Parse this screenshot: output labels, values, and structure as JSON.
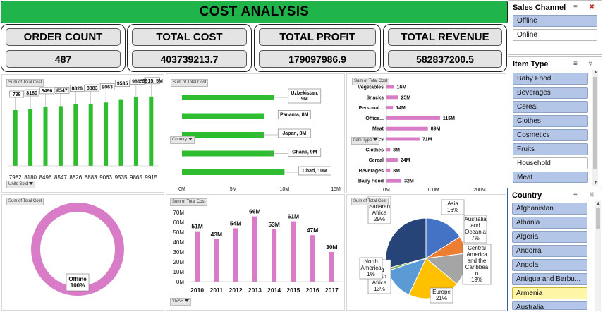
{
  "title": "COST ANALYSIS",
  "kpis": [
    {
      "label": "ORDER COUNT",
      "value": "487"
    },
    {
      "label": "TOTAL COST",
      "value": "403739213.7"
    },
    {
      "label": "TOTAL PROFIT",
      "value": "179097986.9"
    },
    {
      "label": "TOTAL REVENUE",
      "value": "582837200.5"
    }
  ],
  "field_buttons": {
    "sum_total_cost": "Sum of Total Cost",
    "units_sold": "Units Sold",
    "country": "Country",
    "item_type": "Item Type",
    "year": "YEAR"
  },
  "slicers": {
    "sales_channel": {
      "title": "Sales Channel",
      "items": [
        {
          "label": "Offline",
          "state": "selected"
        },
        {
          "label": "Online",
          "state": "unselected"
        }
      ]
    },
    "item_type": {
      "title": "Item Type",
      "items": [
        {
          "label": "Baby Food",
          "state": "selected"
        },
        {
          "label": "Beverages",
          "state": "selected"
        },
        {
          "label": "Cereal",
          "state": "selected"
        },
        {
          "label": "Clothes",
          "state": "selected"
        },
        {
          "label": "Cosmetics",
          "state": "selected"
        },
        {
          "label": "Fruits",
          "state": "selected"
        },
        {
          "label": "Household",
          "state": "unselected"
        },
        {
          "label": "Meat",
          "state": "selected"
        }
      ]
    },
    "country": {
      "title": "Country",
      "items": [
        {
          "label": "Afghanistan",
          "state": "selected"
        },
        {
          "label": "Albania",
          "state": "selected"
        },
        {
          "label": "Algeria",
          "state": "selected"
        },
        {
          "label": "Andorra",
          "state": "selected"
        },
        {
          "label": "Angola",
          "state": "selected"
        },
        {
          "label": "Antigua and Barbu...",
          "state": "selected"
        },
        {
          "label": "Armenia",
          "state": "highlighted"
        },
        {
          "label": "Australia",
          "state": "selected"
        }
      ]
    }
  },
  "chart_data": [
    {
      "id": "units",
      "type": "bar",
      "categories": [
        "7982",
        "8180",
        "8496",
        "8547",
        "8826",
        "8883",
        "9063",
        "9535",
        "9865",
        "9915"
      ],
      "values": [
        7982,
        8180,
        8496,
        8547,
        8826,
        8883,
        9063,
        9535,
        9865,
        9915
      ],
      "data_labels": [
        "798",
        "8180",
        "8496",
        "8547",
        "8826",
        "8883",
        "9063",
        "9535",
        "9865",
        "9915, 5M"
      ],
      "ylim": [
        0,
        10000
      ],
      "color": "#2ebd2e"
    },
    {
      "id": "country",
      "type": "bar",
      "orientation": "horizontal",
      "categories": [
        "Uzbekistan",
        "Panama",
        "Japan",
        "Ghana",
        "Chad"
      ],
      "values": [
        9,
        8,
        8,
        9,
        10
      ],
      "data_labels": [
        "Uzbekistan,\n9M",
        "Panama, 8M",
        "Japan, 8M",
        "Ghana, 9M",
        "Chad, 10M"
      ],
      "xticks": [
        "0M",
        "5M",
        "10M",
        "15M"
      ],
      "xlim": [
        0,
        15
      ],
      "color": "#2ebd2e"
    },
    {
      "id": "itemtype",
      "type": "bar",
      "orientation": "horizontal",
      "categories": [
        "Vegetables",
        "Snacks",
        "Personal...",
        "Office...",
        "Meat",
        "Cosmetics",
        "Clothes",
        "Cereal",
        "Beverages",
        "Baby Food"
      ],
      "values": [
        16,
        25,
        14,
        115,
        89,
        71,
        8,
        24,
        8,
        32
      ],
      "data_labels": [
        "16M",
        "25M",
        "14M",
        "115M",
        "89M",
        "71M",
        "8M",
        "24M",
        "8M",
        "32M"
      ],
      "xticks": [
        "0M",
        "100M",
        "200M"
      ],
      "xlim": [
        0,
        200
      ],
      "color": "#d97cc8"
    },
    {
      "id": "donut",
      "type": "pie",
      "style": "donut",
      "labels": [
        "Offline"
      ],
      "values": [
        100
      ],
      "data_labels": [
        "Offline\n100%"
      ],
      "color": "#d97cc8"
    },
    {
      "id": "years",
      "type": "bar",
      "categories": [
        "2010",
        "2011",
        "2012",
        "2013",
        "2014",
        "2015",
        "2016",
        "2017"
      ],
      "values": [
        51,
        43,
        54,
        66,
        53,
        61,
        47,
        30
      ],
      "data_labels": [
        "51M",
        "43M",
        "54M",
        "66M",
        "53M",
        "61M",
        "47M",
        "30M"
      ],
      "yticks": [
        "0M",
        "10M",
        "20M",
        "30M",
        "40M",
        "50M",
        "60M",
        "70M"
      ],
      "ylim": [
        0,
        70
      ],
      "color": "#d97cc8"
    },
    {
      "id": "regions",
      "type": "pie",
      "labels": [
        "Asia",
        "Australia and Oceania",
        "Central America and the Caribbean",
        "Europe",
        "Middle East and North Africa",
        "North America",
        "Sub-Saharan Africa"
      ],
      "values": [
        16,
        7,
        13,
        21,
        13,
        1,
        29
      ],
      "data_labels": [
        "Asia\n16%",
        "Australia\nand\nOceania\n7%",
        "Central\nAmerica\nand the\nCaribbea\nn\n13%",
        "Europe\n21%",
        "e\nand\nNorth\nAfrica\n13%",
        "North\nAmerica\n1%",
        "Sub-\nSaharan\nAfrica\n29%"
      ],
      "colors": [
        "#4472c4",
        "#ed7d31",
        "#a5a5a5",
        "#ffc000",
        "#5b9bd5",
        "#70ad47",
        "#264478"
      ]
    }
  ]
}
